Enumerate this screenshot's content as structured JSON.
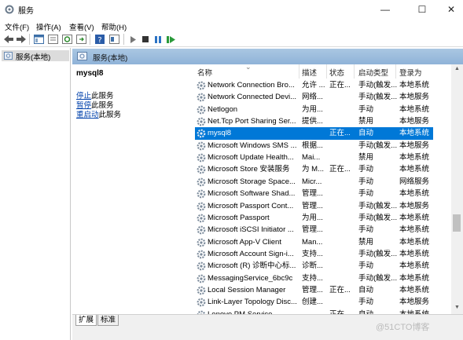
{
  "window": {
    "title": "服务",
    "minimize_glyph": "—",
    "maximize_glyph": "☐",
    "close_glyph": "✕"
  },
  "menu": [
    "文件(F)",
    "操作(A)",
    "查看(V)",
    "帮助(H)"
  ],
  "toolbar_icons": [
    "back-arrow-icon",
    "forward-arrow-icon",
    "console-tree-icon",
    "properties-icon",
    "refresh-icon",
    "export-list-icon",
    "help-icon",
    "show-hide-icon",
    "start-icon",
    "stop-icon",
    "pause-icon",
    "restart-icon"
  ],
  "left_pane": {
    "item": "服务(本地)"
  },
  "right_pane": {
    "header": "服务(本地)"
  },
  "detail": {
    "service_name": "mysql8",
    "actions": [
      {
        "link": "停止",
        "rest": "此服务"
      },
      {
        "link": "暂停",
        "rest": "此服务"
      },
      {
        "link": "重启动",
        "rest": "此服务"
      }
    ]
  },
  "table": {
    "sort_indicator": "⌄",
    "columns": [
      "名称",
      "描述",
      "状态",
      "启动类型",
      "登录为"
    ],
    "rows": [
      [
        "Network Connection Bro...",
        "允许 ...",
        "正在...",
        "手动(触发...",
        "本地系统"
      ],
      [
        "Network Connected Devi...",
        "网络...",
        "",
        "手动(触发...",
        "本地服务"
      ],
      [
        "Netlogon",
        "为用...",
        "",
        "手动",
        "本地系统"
      ],
      [
        "Net.Tcp Port Sharing Ser...",
        "提供...",
        "",
        "禁用",
        "本地服务"
      ],
      [
        "mysql8",
        "",
        "正在...",
        "自动",
        "本地系统"
      ],
      [
        "Microsoft Windows SMS ...",
        "根据...",
        "",
        "手动(触发...",
        "本地服务"
      ],
      [
        "Microsoft Update Health...",
        "Mai...",
        "",
        "禁用",
        "本地系统"
      ],
      [
        "Microsoft Store 安装服务",
        "为 M...",
        "正在...",
        "手动",
        "本地系统"
      ],
      [
        "Microsoft Storage Space...",
        "Micr...",
        "",
        "手动",
        "网络服务"
      ],
      [
        "Microsoft Software Shad...",
        "管理...",
        "",
        "手动",
        "本地系统"
      ],
      [
        "Microsoft Passport Cont...",
        "管理...",
        "",
        "手动(触发...",
        "本地服务"
      ],
      [
        "Microsoft Passport",
        "为用...",
        "",
        "手动(触发...",
        "本地系统"
      ],
      [
        "Microsoft iSCSI Initiator ...",
        "管理...",
        "",
        "手动",
        "本地系统"
      ],
      [
        "Microsoft App-V Client",
        "Man...",
        "",
        "禁用",
        "本地系统"
      ],
      [
        "Microsoft Account Sign-i...",
        "支持...",
        "",
        "手动(触发...",
        "本地系统"
      ],
      [
        "Microsoft (R) 诊断中心标...",
        "诊断...",
        "",
        "手动",
        "本地系统"
      ],
      [
        "MessagingService_6bc9c",
        "支持...",
        "",
        "手动(触发...",
        "本地系统"
      ],
      [
        "Local Session Manager",
        "管理...",
        "正在...",
        "自动",
        "本地系统"
      ],
      [
        "Link-Layer Topology Disc...",
        "创建...",
        "",
        "手动",
        "本地服务"
      ],
      [
        "Lenovo PM Service",
        "",
        "正在...",
        "自动",
        "本地系统"
      ]
    ],
    "selected_index": 4
  },
  "tabs": [
    "扩展",
    "标准"
  ],
  "watermark": "@51CTO博客",
  "colors": {
    "selection": "#0078d7",
    "header": "#8fb3d8",
    "link": "#0645ad"
  }
}
